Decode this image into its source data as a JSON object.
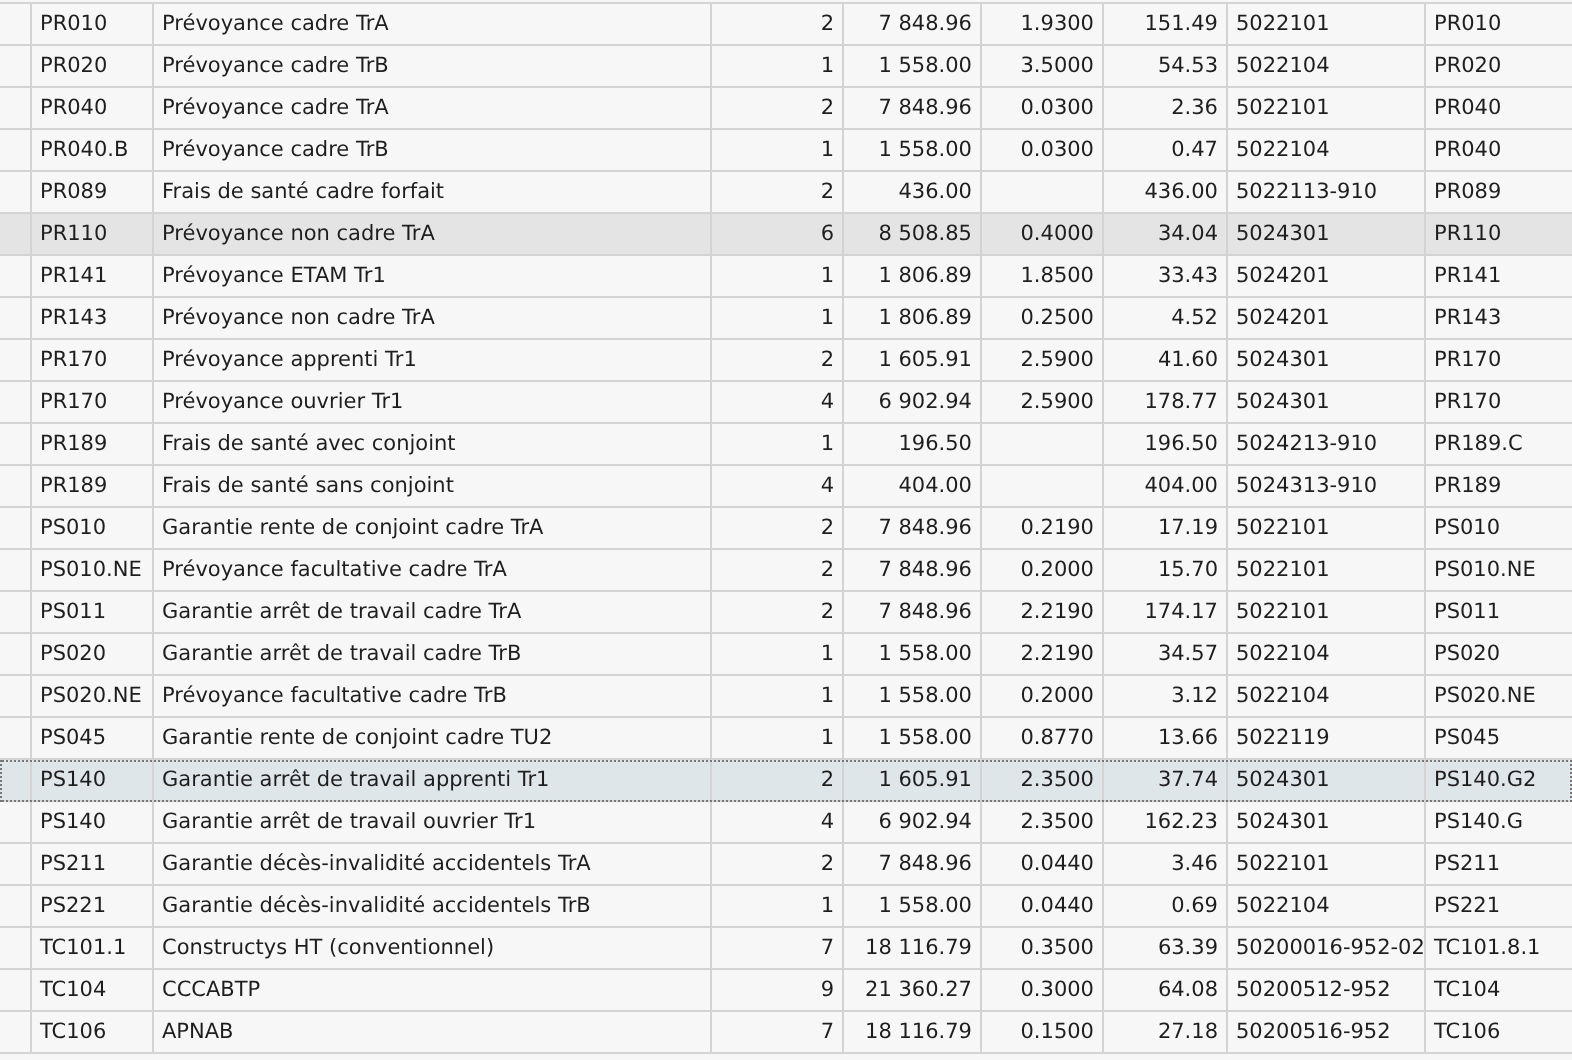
{
  "table": {
    "rows": [
      {
        "selected": false,
        "highlighted": false,
        "column_1": "PR010",
        "column_2": "Prévoyance cadre TrA",
        "column_3": "2",
        "column_4": "7 848.96",
        "column_5": "1.9300",
        "column_6": "151.49",
        "column_7": "5022101",
        "column_8": "PR010"
      },
      {
        "selected": false,
        "highlighted": false,
        "column_1": "PR020",
        "column_2": "Prévoyance cadre TrB",
        "column_3": "1",
        "column_4": "1 558.00",
        "column_5": "3.5000",
        "column_6": "54.53",
        "column_7": "5022104",
        "column_8": "PR020"
      },
      {
        "selected": false,
        "highlighted": false,
        "column_1": "PR040",
        "column_2": "Prévoyance cadre TrA",
        "column_3": "2",
        "column_4": "7 848.96",
        "column_5": "0.0300",
        "column_6": "2.36",
        "column_7": "5022101",
        "column_8": "PR040"
      },
      {
        "selected": false,
        "highlighted": false,
        "column_1": "PR040.B",
        "column_2": "Prévoyance cadre TrB",
        "column_3": "1",
        "column_4": "1 558.00",
        "column_5": "0.0300",
        "column_6": "0.47",
        "column_7": "5022104",
        "column_8": "PR040"
      },
      {
        "selected": false,
        "highlighted": false,
        "column_1": "PR089",
        "column_2": "Frais de santé cadre forfait",
        "column_3": "2",
        "column_4": "436.00",
        "column_6": "436.00",
        "column_7": "5022113-910",
        "column_8": "PR089"
      },
      {
        "selected": false,
        "highlighted": true,
        "column_1": "PR110",
        "column_2": "Prévoyance non cadre TrA",
        "column_3": "6",
        "column_4": "8 508.85",
        "column_5": "0.4000",
        "column_6": "34.04",
        "column_7": "5024301",
        "column_8": "PR110"
      },
      {
        "selected": false,
        "highlighted": false,
        "column_1": "PR141",
        "column_2": "Prévoyance ETAM Tr1",
        "column_3": "1",
        "column_4": "1 806.89",
        "column_5": "1.8500",
        "column_6": "33.43",
        "column_7": "5024201",
        "column_8": "PR141"
      },
      {
        "selected": false,
        "highlighted": false,
        "column_1": "PR143",
        "column_2": "Prévoyance non cadre TrA",
        "column_3": "1",
        "column_4": "1 806.89",
        "column_5": "0.2500",
        "column_6": "4.52",
        "column_7": "5024201",
        "column_8": "PR143"
      },
      {
        "selected": false,
        "highlighted": false,
        "column_1": "PR170",
        "column_2": "Prévoyance apprenti Tr1",
        "column_3": "2",
        "column_4": "1 605.91",
        "column_5": "2.5900",
        "column_6": "41.60",
        "column_7": "5024301",
        "column_8": "PR170"
      },
      {
        "selected": false,
        "highlighted": false,
        "column_1": "PR170",
        "column_2": "Prévoyance ouvrier Tr1",
        "column_3": "4",
        "column_4": "6 902.94",
        "column_5": "2.5900",
        "column_6": "178.77",
        "column_7": "5024301",
        "column_8": "PR170"
      },
      {
        "selected": false,
        "highlighted": false,
        "column_1": "PR189",
        "column_2": "Frais de santé avec conjoint",
        "column_3": "1",
        "column_4": "196.50",
        "column_6": "196.50",
        "column_7": "5024213-910",
        "column_8": "PR189.C"
      },
      {
        "selected": false,
        "highlighted": false,
        "column_1": "PR189",
        "column_2": "Frais de santé sans conjoint",
        "column_3": "4",
        "column_4": "404.00",
        "column_6": "404.00",
        "column_7": "5024313-910",
        "column_8": "PR189"
      },
      {
        "selected": false,
        "highlighted": false,
        "column_1": "PS010",
        "column_2": "Garantie rente de conjoint cadre TrA",
        "column_3": "2",
        "column_4": "7 848.96",
        "column_5": "0.2190",
        "column_6": "17.19",
        "column_7": "5022101",
        "column_8": "PS010"
      },
      {
        "selected": false,
        "highlighted": false,
        "column_1": "PS010.NE",
        "column_2": "Prévoyance facultative cadre TrA",
        "column_3": "2",
        "column_4": "7 848.96",
        "column_5": "0.2000",
        "column_6": "15.70",
        "column_7": "5022101",
        "column_8": "PS010.NE"
      },
      {
        "selected": false,
        "highlighted": false,
        "column_1": "PS011",
        "column_2": "Garantie arrêt de travail cadre TrA",
        "column_3": "2",
        "column_4": "7 848.96",
        "column_5": "2.2190",
        "column_6": "174.17",
        "column_7": "5022101",
        "column_8": "PS011"
      },
      {
        "selected": false,
        "highlighted": false,
        "column_1": "PS020",
        "column_2": "Garantie arrêt de travail cadre TrB",
        "column_3": "1",
        "column_4": "1 558.00",
        "column_5": "2.2190",
        "column_6": "34.57",
        "column_7": "5022104",
        "column_8": "PS020"
      },
      {
        "selected": false,
        "highlighted": false,
        "column_1": "PS020.NE",
        "column_2": "Prévoyance facultative cadre TrB",
        "column_3": "1",
        "column_4": "1 558.00",
        "column_5": "0.2000",
        "column_6": "3.12",
        "column_7": "5022104",
        "column_8": "PS020.NE"
      },
      {
        "selected": false,
        "highlighted": false,
        "column_1": "PS045",
        "column_2": "Garantie rente de conjoint cadre TU2",
        "column_3": "1",
        "column_4": "1 558.00",
        "column_5": "0.8770",
        "column_6": "13.66",
        "column_7": "5022119",
        "column_8": "PS045"
      },
      {
        "selected": true,
        "highlighted": false,
        "column_1": "PS140",
        "column_2": "Garantie arrêt de travail apprenti Tr1",
        "column_3": "2",
        "column_4": "1 605.91",
        "column_5": "2.3500",
        "column_6": "37.74",
        "column_7": "5024301",
        "column_8": "PS140.G2"
      },
      {
        "selected": false,
        "highlighted": false,
        "column_1": "PS140",
        "column_2": "Garantie arrêt de travail ouvrier Tr1",
        "column_3": "4",
        "column_4": "6 902.94",
        "column_5": "2.3500",
        "column_6": "162.23",
        "column_7": "5024301",
        "column_8": "PS140.G"
      },
      {
        "selected": false,
        "highlighted": false,
        "column_1": "PS211",
        "column_2": "Garantie décès-invalidité accidentels TrA",
        "column_3": "2",
        "column_4": "7 848.96",
        "column_5": "0.0440",
        "column_6": "3.46",
        "column_7": "5022101",
        "column_8": "PS211"
      },
      {
        "selected": false,
        "highlighted": false,
        "column_1": "PS221",
        "column_2": "Garantie décès-invalidité accidentels TrB",
        "column_3": "1",
        "column_4": "1 558.00",
        "column_5": "0.0440",
        "column_6": "0.69",
        "column_7": "5022104",
        "column_8": "PS221"
      },
      {
        "selected": false,
        "highlighted": false,
        "column_1": "TC101.1",
        "column_2": "Constructys HT (conventionnel)",
        "column_3": "7",
        "column_4": "18 116.79",
        "column_5": "0.3500",
        "column_6": "63.39",
        "column_7": "50200016-952-02",
        "column_8": "TC101.8.1"
      },
      {
        "selected": false,
        "highlighted": false,
        "column_1": "TC104",
        "column_2": "CCCABTP",
        "column_3": "9",
        "column_4": "21 360.27",
        "column_5": "0.3000",
        "column_6": "64.08",
        "column_7": "50200512-952",
        "column_8": "TC104"
      },
      {
        "selected": false,
        "highlighted": false,
        "column_1": "TC106",
        "column_2": "APNAB",
        "column_3": "7",
        "column_4": "18 116.79",
        "column_5": "0.1500",
        "column_6": "27.18",
        "column_7": "50200516-952",
        "column_8": "TC106"
      }
    ]
  }
}
